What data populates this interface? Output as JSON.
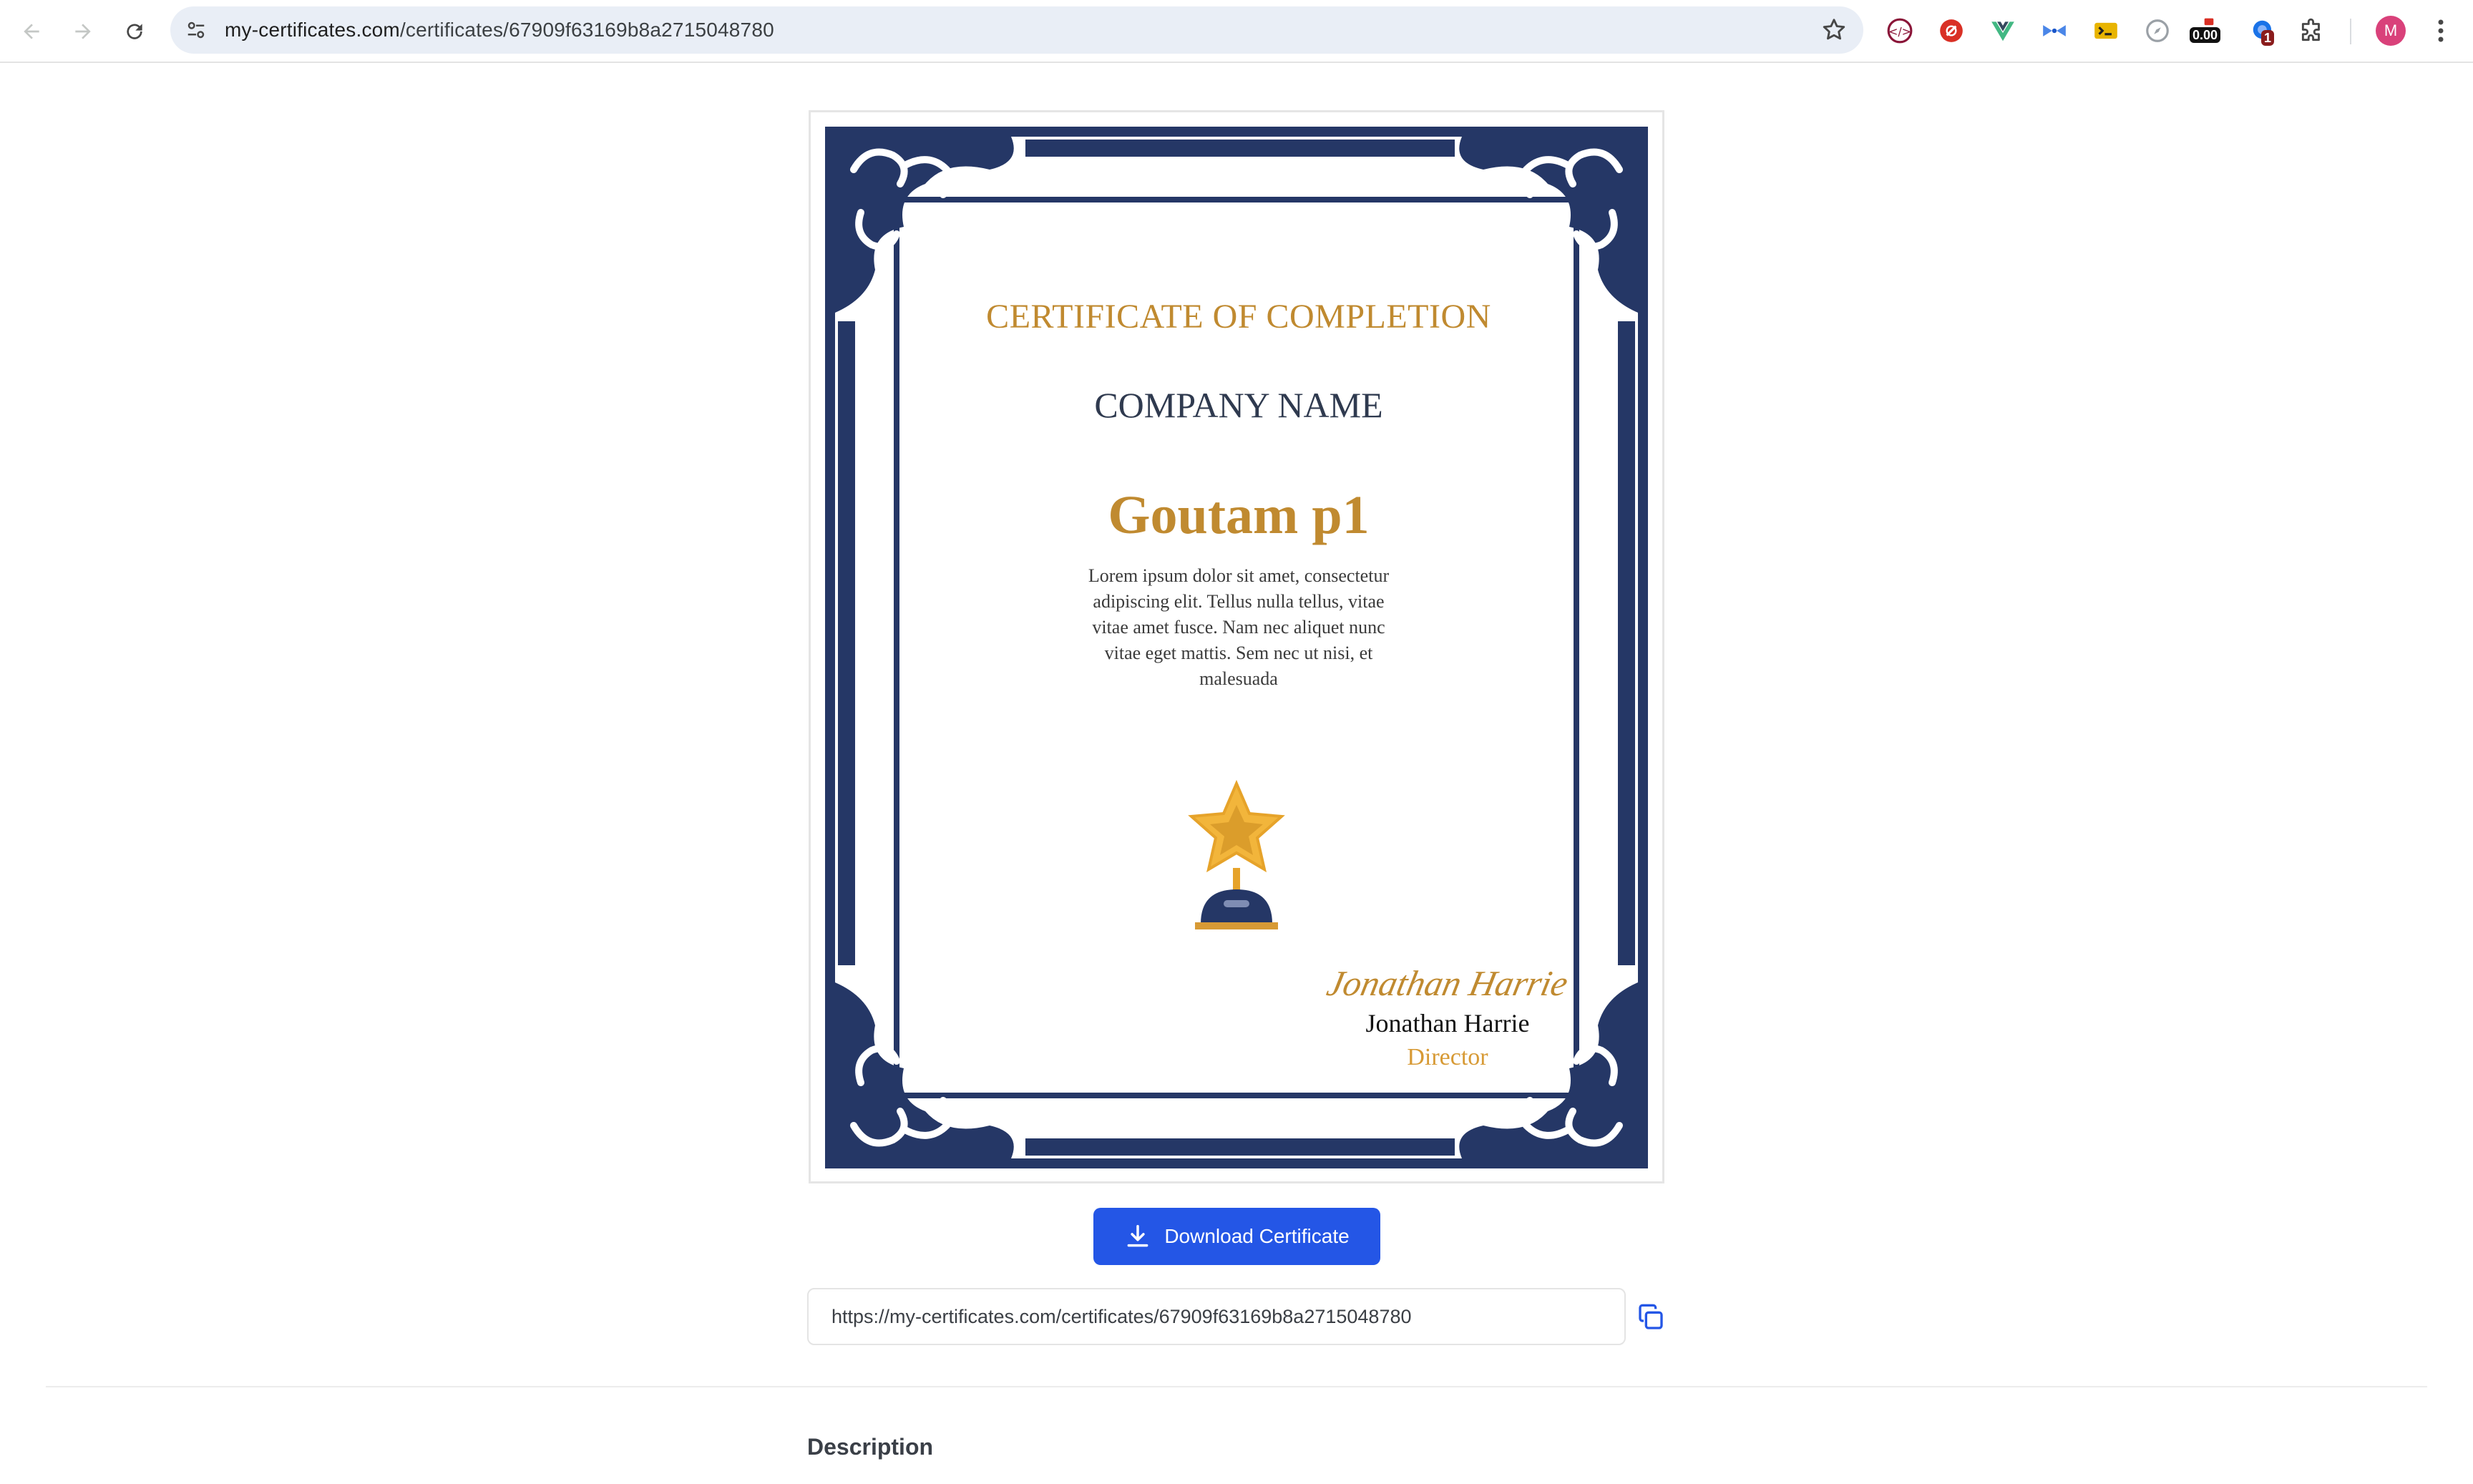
{
  "browser": {
    "url_host": "my-certificates.com",
    "url_path": "/certificates/67909f63169b8a2715048780",
    "extensions": [
      {
        "name": "code-tag-extension-icon",
        "color": "#8a1538"
      },
      {
        "name": "red-circle-extension-icon",
        "color": "#d93025"
      },
      {
        "name": "vue-devtools-icon",
        "color": "#42b883"
      },
      {
        "name": "bow-extension-icon",
        "color": "#4a86e8"
      },
      {
        "name": "terminal-extension-icon",
        "color": "#e8b400"
      },
      {
        "name": "compass-extension-icon",
        "color": "#9aa0a6"
      },
      {
        "name": "counter-extension-icon",
        "color": "#111111",
        "badge": "0.00"
      },
      {
        "name": "cloud-extension-icon",
        "color": "#1a73e8",
        "badge": "1"
      }
    ],
    "avatar_letter": "M",
    "avatar_color": "#d9417a"
  },
  "certificate": {
    "title": "CERTIFICATE OF COMPLETION",
    "company": "COMPANY NAME",
    "recipient": "Goutam p1",
    "body": "Lorem ipsum dolor sit amet, consectetur adipiscing elit. Tellus nulla tellus, vitae vitae amet fusce. Nam nec aliquet nunc vitae eget mattis. Sem nec ut nisi, et malesuada",
    "signature": "Jonathan Harrie",
    "signer_name": "Jonathan Harrie",
    "signer_title": "Director",
    "border_color": "#253766",
    "accent_color": "#c08a30"
  },
  "actions": {
    "download_label": "Download Certificate",
    "share_url": "https://my-certificates.com/certificates/67909f63169b8a2715048780",
    "button_color": "#2456e6"
  },
  "sections": {
    "description_heading": "Description"
  }
}
